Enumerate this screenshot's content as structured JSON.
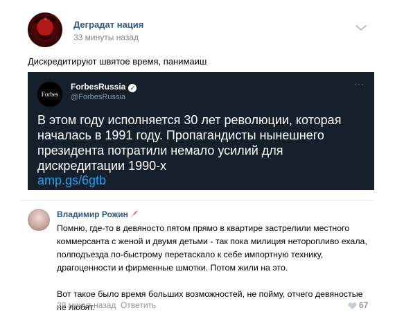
{
  "post": {
    "group_name": "Деградат нация",
    "time": "33 минуты назад",
    "text": "Дискредитируют швятое время, панимаиш"
  },
  "tweet": {
    "avatar_text": "Forbes",
    "name": "ForbesRussia",
    "handle": "@ForbesRussia",
    "body": "В этом году исполняется 30 лет революции, которая началась в 1991 году. Пропагандисты нынешнего президента потратили немало усилий для дискредитации 1990-х",
    "link": "amp.gs/6gtb",
    "more": "···"
  },
  "comment": {
    "author": "Владимир Рожин",
    "paragraph1": "Помню, где-то в девяносто пятом прямо в квартире застрелили местного коммерсанта с женой и двумя детьми - так пока милиция неторопливо ехала, полподъезда по-быстрому перетаскало к себе импортную технику, драгоценности и фирменные шмотки. Потом жили на это.",
    "paragraph2": "Вот такое было время больших возможностей, не пойму, отчего девяностые не любят.",
    "time": "29 минут назад",
    "reply_label": "Ответить",
    "likes": "67"
  },
  "icons": {
    "chevron": "chevron-down-icon",
    "verified": "verified-badge-icon",
    "feather": "feather-icon",
    "heart": "heart-icon"
  },
  "colors": {
    "link": "#2a5885",
    "tweet_bg": "#15202b",
    "tweet_link": "#1da1f2",
    "muted": "#828282"
  }
}
